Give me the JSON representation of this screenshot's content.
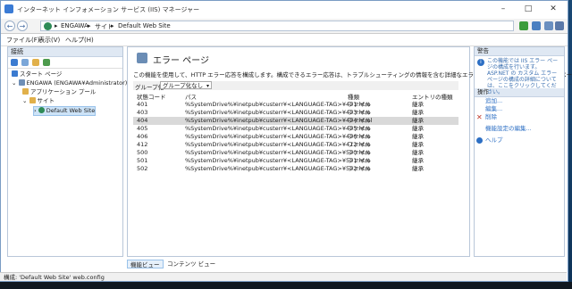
{
  "window": {
    "title": "インターネット インフォメーション サービス (IIS) マネージャー"
  },
  "address": {
    "crumbs": [
      "ENGAWA",
      "サイト",
      "Default Web Site"
    ]
  },
  "menu": {
    "items": [
      "ファイル(F)",
      "表示(V)",
      "ヘルプ(H)"
    ]
  },
  "connections": {
    "header": "接続",
    "tree": [
      {
        "label": "スタート ページ",
        "level": 0
      },
      {
        "label": "ENGAWA (ENGAWA¥Administrator)",
        "level": 0
      },
      {
        "label": "アプリケーション プール",
        "level": 1
      },
      {
        "label": "サイト",
        "level": 1
      },
      {
        "label": "Default Web Site",
        "level": 2,
        "selected": true
      }
    ]
  },
  "page": {
    "title": "エラー ページ",
    "description": "この機能を使用して、HTTP エラー応答を構成します。構成できるエラー応答は、トラブルシューティングの情報を含む詳細なエラー メッセージやカスタム エラー ページです。",
    "group_label": "グループ化:",
    "group_value": "グループ化なし",
    "columns": [
      "状態コード",
      "パス",
      "種類",
      "エントリの種類"
    ],
    "rows": [
      {
        "code": "401",
        "path": "%SystemDrive%¥inetpub¥custerr¥<LANGUAGE-TAG>¥401.htm",
        "type": "ファイル",
        "entry": "継承"
      },
      {
        "code": "403",
        "path": "%SystemDrive%¥inetpub¥custerr¥<LANGUAGE-TAG>¥403.htm",
        "type": "ファイル",
        "entry": "継承"
      },
      {
        "code": "404",
        "path": "%SystemDrive%¥inetpub¥custerr¥<LANGUAGE-TAG>¥404.html",
        "type": "ファイル",
        "entry": "継承",
        "selected": true
      },
      {
        "code": "405",
        "path": "%SystemDrive%¥inetpub¥custerr¥<LANGUAGE-TAG>¥405.htm",
        "type": "ファイル",
        "entry": "継承"
      },
      {
        "code": "406",
        "path": "%SystemDrive%¥inetpub¥custerr¥<LANGUAGE-TAG>¥406.htm",
        "type": "ファイル",
        "entry": "継承"
      },
      {
        "code": "412",
        "path": "%SystemDrive%¥inetpub¥custerr¥<LANGUAGE-TAG>¥412.htm",
        "type": "ファイル",
        "entry": "継承"
      },
      {
        "code": "500",
        "path": "%SystemDrive%¥inetpub¥custerr¥<LANGUAGE-TAG>¥500.htm",
        "type": "ファイル",
        "entry": "継承"
      },
      {
        "code": "501",
        "path": "%SystemDrive%¥inetpub¥custerr¥<LANGUAGE-TAG>¥501.htm",
        "type": "ファイル",
        "entry": "継承"
      },
      {
        "code": "502",
        "path": "%SystemDrive%¥inetpub¥custerr¥<LANGUAGE-TAG>¥502.htm",
        "type": "ファイル",
        "entry": "継承"
      }
    ]
  },
  "tabs": [
    "機能ビュー",
    "コンテンツ ビュー"
  ],
  "actions": {
    "alert_header": "警告",
    "alert_text": "この機能では IIS エラー ページの構成を行います。ASP.NET の カスタム エラー ページの構成の詳細については、ここをクリックしてください。",
    "header": "操作",
    "items": [
      {
        "label": "追加...",
        "icon": "none"
      },
      {
        "label": "編集...",
        "icon": "none"
      },
      {
        "label": "削除",
        "icon": "delete-icon"
      },
      {
        "label": "機能設定の編集...",
        "icon": "none"
      },
      {
        "label": "ヘルプ",
        "icon": "help-icon"
      }
    ]
  },
  "status": {
    "text": "構成: 'Default Web Site' web.config"
  }
}
